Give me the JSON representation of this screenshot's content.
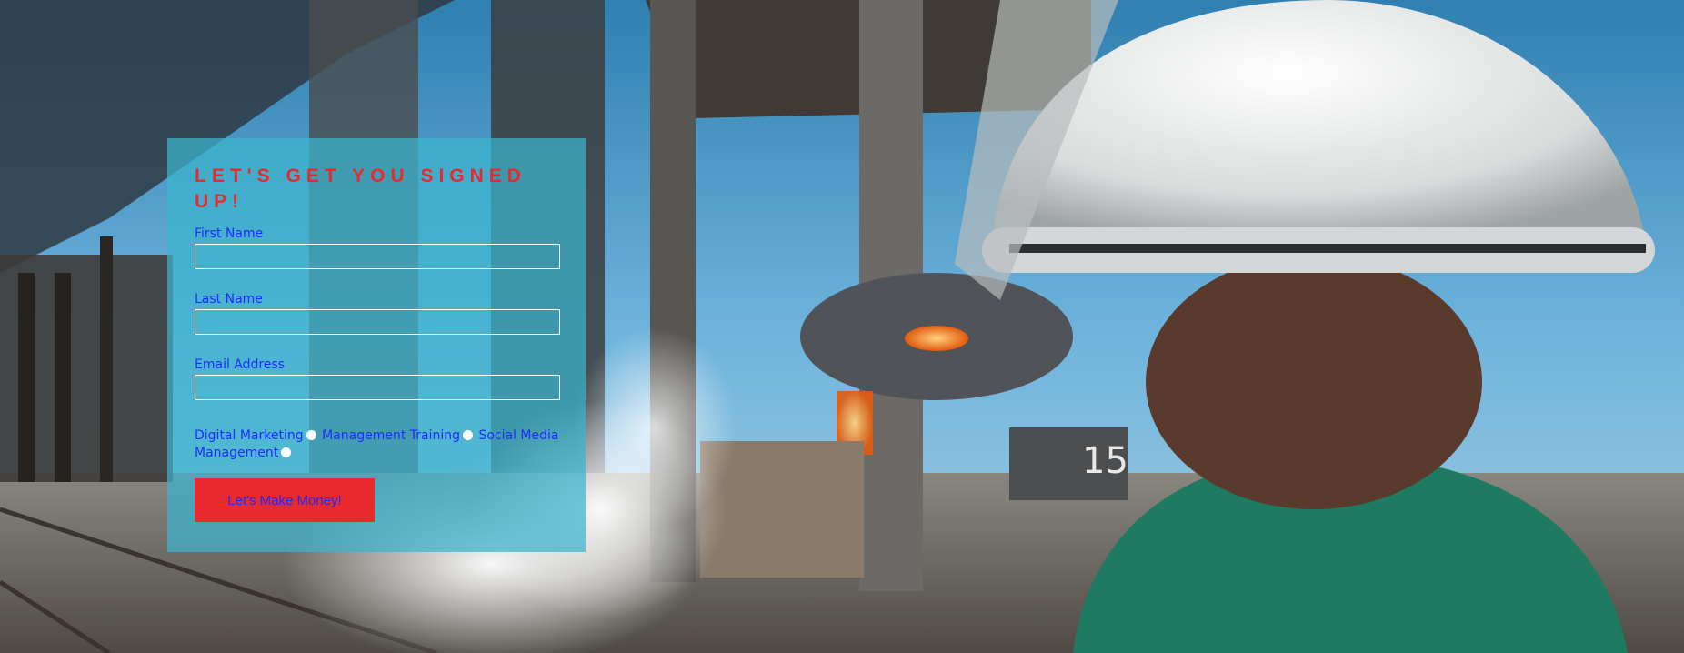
{
  "form": {
    "title": "LET'S GET YOU SIGNED UP!",
    "fields": {
      "first_name": {
        "label": "First Name",
        "value": ""
      },
      "last_name": {
        "label": "Last Name",
        "value": ""
      },
      "email": {
        "label": "Email Address",
        "value": ""
      }
    },
    "interests": [
      {
        "label": "Digital Marketing"
      },
      {
        "label": "Management Training"
      },
      {
        "label": "Social Media Management"
      }
    ],
    "submit_label": "Let's Make Money!"
  },
  "colors": {
    "title": "#e8292e",
    "label": "#1c2cff",
    "button_bg": "#e8292e",
    "panel_bg": "rgba(60,180,205,0.72)"
  }
}
